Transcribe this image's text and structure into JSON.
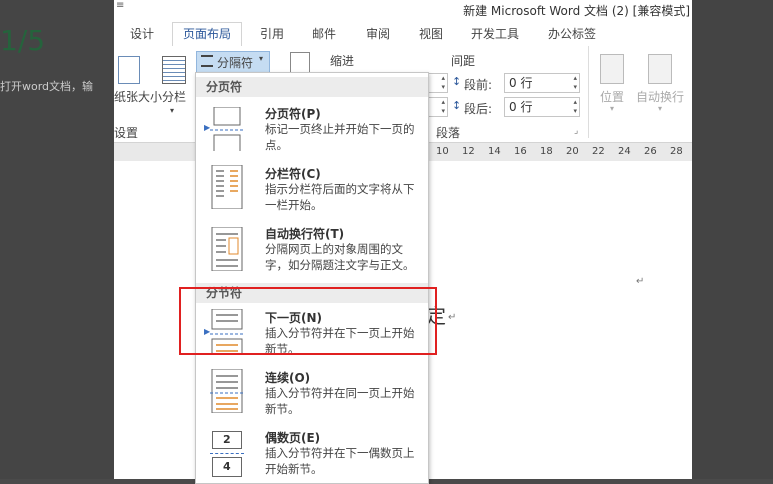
{
  "background": {
    "step_counter": "1/5",
    "hint_text": "打开word文档，输"
  },
  "window": {
    "title": "新建 Microsoft Word 文档 (2) [兼容模式]",
    "control_glyph": "≡"
  },
  "tabs": [
    {
      "label": "设计"
    },
    {
      "label": "页面布局",
      "active": true
    },
    {
      "label": "引用"
    },
    {
      "label": "邮件"
    },
    {
      "label": "审阅"
    },
    {
      "label": "视图"
    },
    {
      "label": "开发工具"
    },
    {
      "label": "办公标签"
    }
  ],
  "ribbon": {
    "size_label": "纸张大小",
    "columns_label": "分栏",
    "group_page_setup": "设置",
    "breaks_label": "分隔符",
    "indent_label": "缩进",
    "spacing_label": "间距",
    "before_label": "段前:",
    "before_value": "0 行",
    "after_label": "段后:",
    "after_value": "0 行",
    "group_paragraph": "段落",
    "position_label": "位置",
    "wrap_label": "自动换行"
  },
  "ruler": [
    "10",
    "12",
    "14",
    "16",
    "18",
    "20",
    "22",
    "24",
    "26",
    "28"
  ],
  "document": {
    "text_fragment": "定",
    "para_mark": "↵"
  },
  "menu": {
    "section_page_breaks": "分页符",
    "section_section_breaks": "分节符",
    "items": [
      {
        "title": "分页符(P)",
        "desc": "标记一页终止并开始下一页的点。"
      },
      {
        "title": "分栏符(C)",
        "desc": "指示分栏符后面的文字将从下一栏开始。"
      },
      {
        "title": "自动换行符(T)",
        "desc": "分隔网页上的对象周围的文字，如分隔题注文字与正文。"
      },
      {
        "title": "下一页(N)",
        "desc": "插入分节符并在下一页上开始新节。"
      },
      {
        "title": "连续(O)",
        "desc": "插入分节符并在同一页上开始新节。"
      },
      {
        "title": "偶数页(E)",
        "desc": "插入分节符并在下一偶数页上开始新节。"
      }
    ],
    "even_icon_numbers": [
      "2",
      "4"
    ]
  },
  "colors": {
    "accent": "#2b579a",
    "highlight": "#e02020",
    "icon_orange": "#e08a2c"
  }
}
